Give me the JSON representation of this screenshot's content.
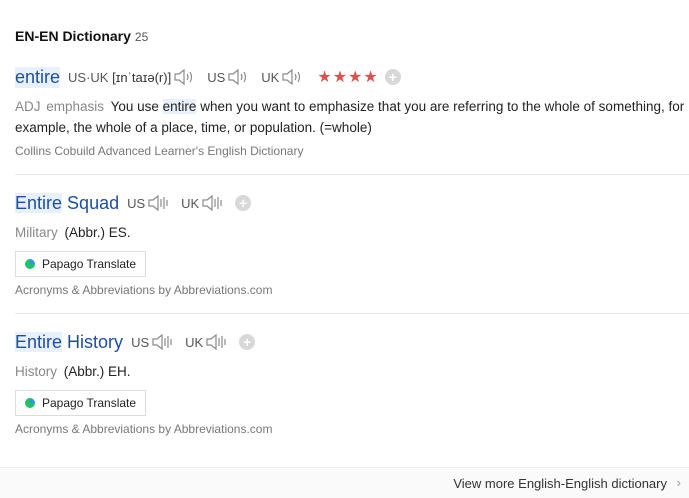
{
  "section": {
    "title": "EN-EN Dictionary",
    "count": "25"
  },
  "entries": [
    {
      "headword": "entire",
      "pron": [
        {
          "label": "US·UK",
          "ipa": "[ɪnˈtaɪə(r)]"
        },
        {
          "label": "US"
        },
        {
          "label": "UK"
        }
      ],
      "stars": "★★★★",
      "pos": "ADJ",
      "category": "emphasis",
      "definition_pre": "You use",
      "definition_kw": "entire",
      "definition_post": "when you want to emphasize that you are referring to the whole of something, for example, the whole of a place, time, or population. (=whole)",
      "source": "Collins Cobuild Advanced Learner's English Dictionary"
    },
    {
      "headword_hl": "Entire",
      "headword_rest": "Squad",
      "pron": [
        {
          "label": "US"
        },
        {
          "label": "UK"
        }
      ],
      "category": "Military",
      "definition": "(Abbr.) ES.",
      "translate_button": "Papago Translate",
      "source": "Acronyms & Abbreviations by Abbreviations.com"
    },
    {
      "headword_hl": "Entire",
      "headword_rest": "History",
      "pron": [
        {
          "label": "US"
        },
        {
          "label": "UK"
        }
      ],
      "category": "History",
      "definition": "(Abbr.) EH.",
      "translate_button": "Papago Translate",
      "source": "Acronyms & Abbreviations by Abbreviations.com"
    }
  ],
  "footer": {
    "more_link": "View more English-English dictionary"
  },
  "colors": {
    "headword": "#1d4ea3",
    "stars": "#d9534f",
    "highlight": "#e8f0fb"
  },
  "icons": {
    "speaker": "speaker-icon",
    "add": "plus-circle-icon",
    "papago": "papago-logo-icon",
    "chevron": "chevron-right-icon"
  }
}
